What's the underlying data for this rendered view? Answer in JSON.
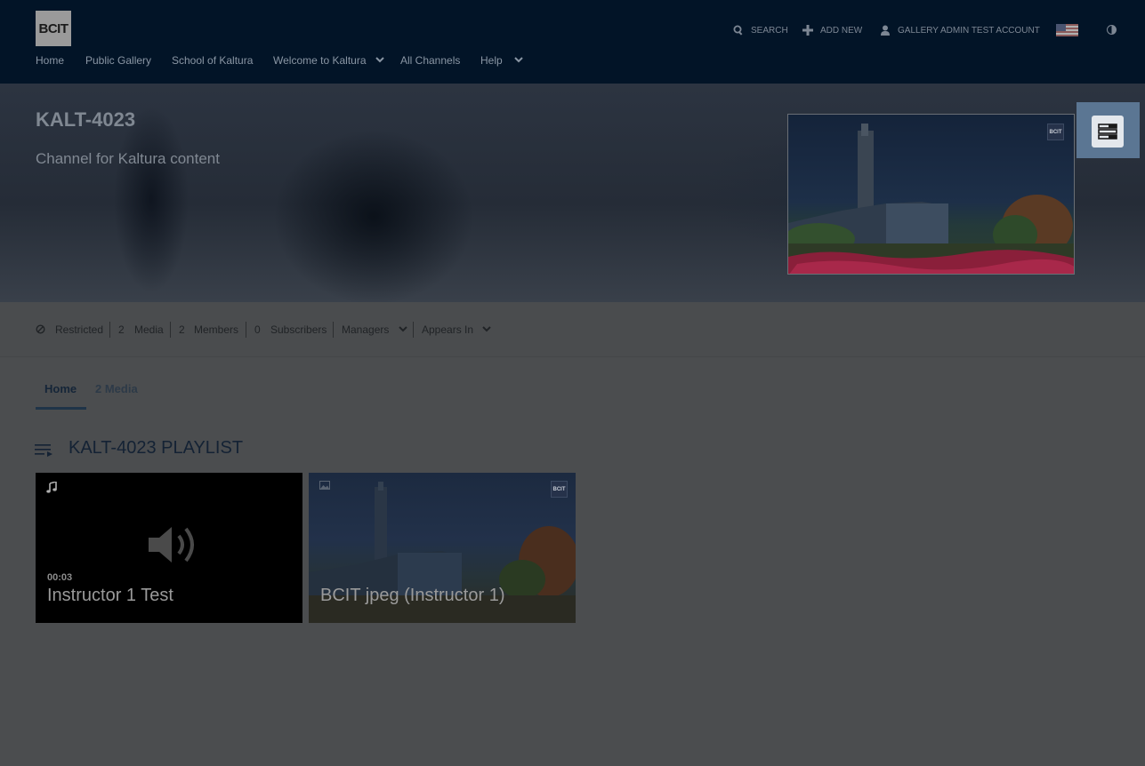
{
  "brand": {
    "logo_text": "BCIT"
  },
  "header": {
    "search_label": "SEARCH",
    "add_new_label": "ADD NEW",
    "account_label": "GALLERY ADMIN TEST ACCOUNT"
  },
  "nav": {
    "items": [
      "Home",
      "Public Gallery",
      "School of Kaltura",
      "Welcome to Kaltura",
      "All Channels",
      "Help"
    ]
  },
  "channel": {
    "title": "KALT-4023",
    "description": "Channel for Kaltura content",
    "thumb_badge": "BCIT"
  },
  "meta": {
    "privacy": "Restricted",
    "media_count": "2",
    "media_label": "Media",
    "members_count": "2",
    "members_label": "Members",
    "subscribers_count": "0",
    "subscribers_label": "Subscribers",
    "managers_label": "Managers",
    "appears_in_label": "Appears In"
  },
  "tabs": {
    "home": "Home",
    "media": "2 Media"
  },
  "playlist": {
    "title": "KALT-4023 PLAYLIST",
    "items": [
      {
        "duration": "00:03",
        "title": "Instructor 1 Test",
        "type_icon": "music-note-icon"
      },
      {
        "title": "BCIT jpeg (Instructor 1)",
        "type_icon": "image-icon",
        "badge": "BCIT"
      }
    ]
  },
  "colors": {
    "header_bg": "#021427",
    "overlay_bg": "#4b4d4f",
    "sidebar_button": "#5b7693"
  }
}
